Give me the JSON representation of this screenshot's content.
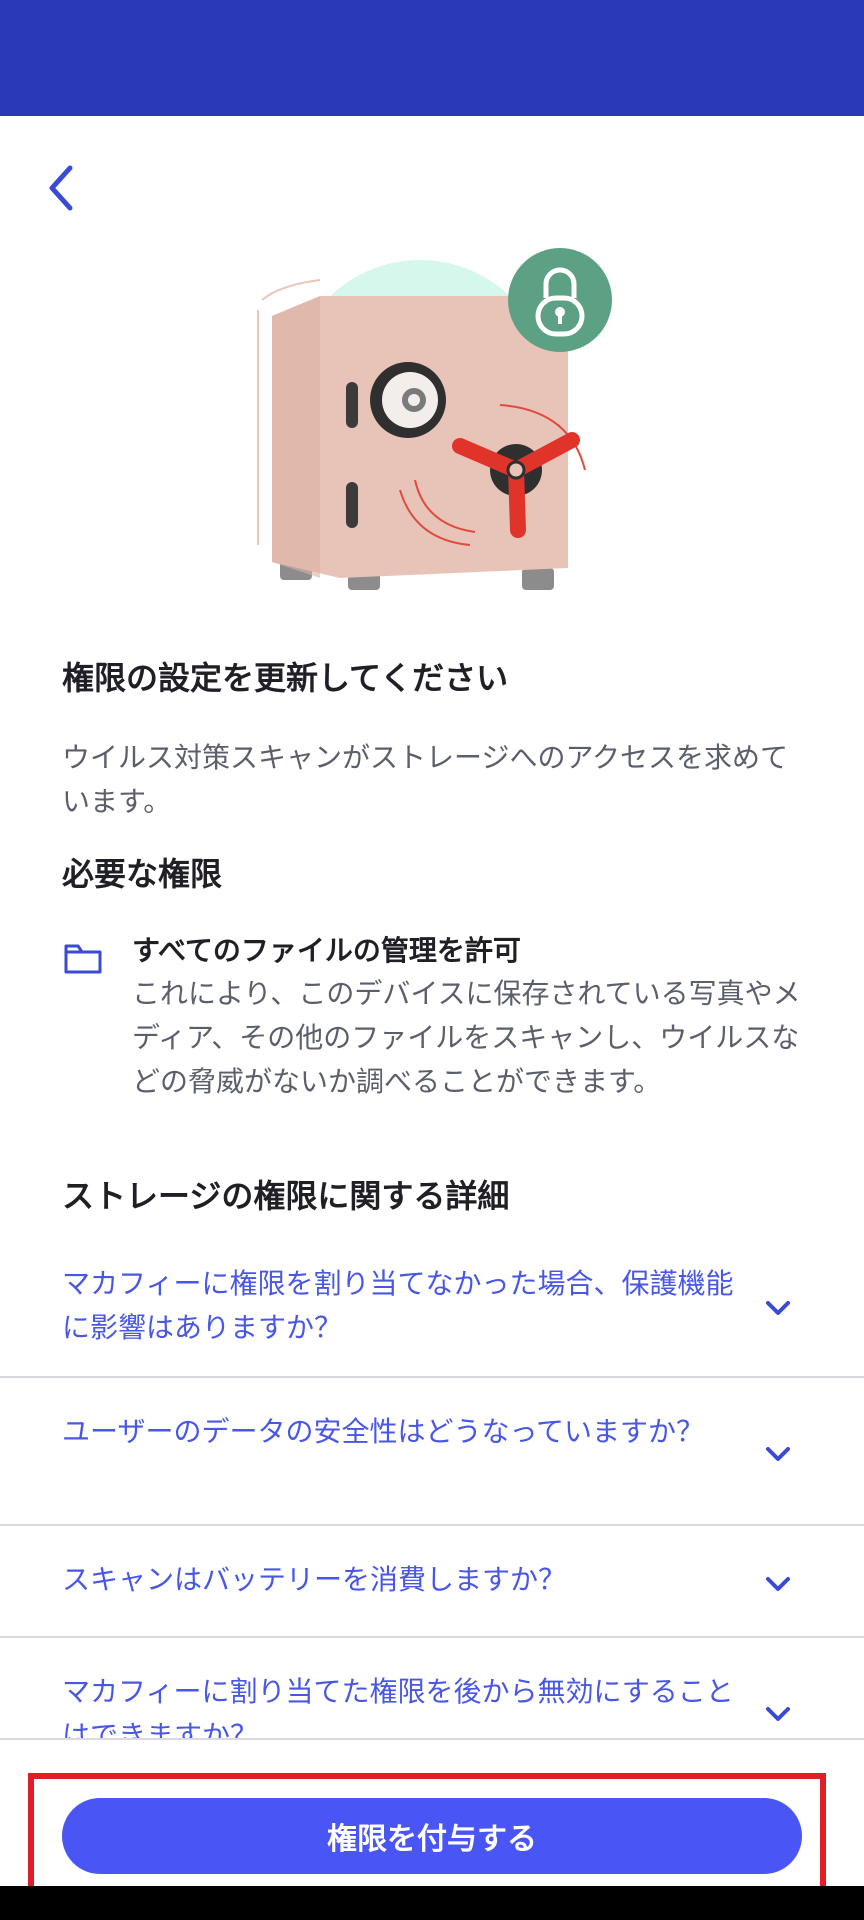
{
  "colors": {
    "status_bar": "#2a39b8",
    "accent": "#4956f5",
    "link": "#4957e6",
    "highlight": "#e01e25"
  },
  "header": {
    "back_icon": "chevron-left-icon"
  },
  "hero": {
    "illustration": "safe-with-lock-illustration"
  },
  "main": {
    "title": "権限の設定を更新してください",
    "intro": "ウイルス対策スキャンがストレージへのアクセスを求めています。",
    "required_heading": "必要な権限",
    "permission": {
      "icon": "folder-icon",
      "title": "すべてのファイルの管理を許可",
      "description": "これにより、このデバイスに保存されている写真やメディア、その他のファイルをスキャンし、ウイルスなどの脅威がないか調べることができます。"
    },
    "details_heading": "ストレージの権限に関する詳細",
    "faq": [
      {
        "question": "マカフィーに権限を割り当てなかった場合、保護機能に影響はありますか？"
      },
      {
        "question": "ユーザーのデータの安全性はどうなっていますか？"
      },
      {
        "question": "スキャンはバッテリーを消費しますか？"
      },
      {
        "question": "マカフィーに割り当てた権限を後から無効にすることはできますか？"
      }
    ]
  },
  "footer": {
    "grant_label": "権限を付与する"
  }
}
